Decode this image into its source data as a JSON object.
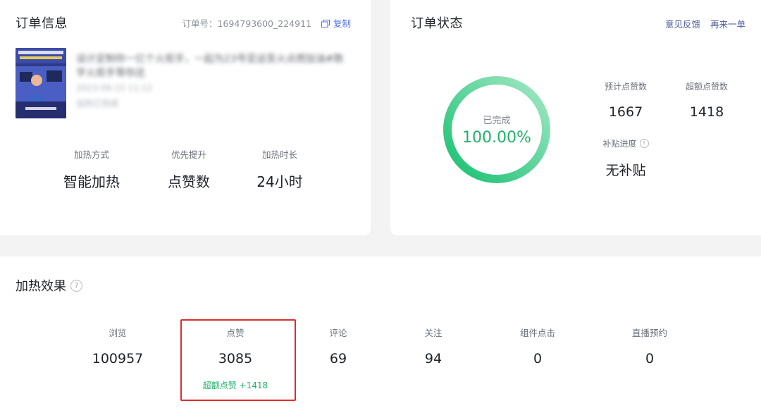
{
  "order_info": {
    "title": "订单信息",
    "order_no_label": "订单号：1694793600_224911",
    "copy_label": "复制",
    "video": {
      "thumbnail_text": "数字人",
      "title": "设计定制你一亿个火炬手，一起为23号亚运圣火点燃加油#数字火炬手等你还",
      "date": "2023-09-15 11:12",
      "status": "加热已完成"
    },
    "stats": [
      {
        "label": "加热方式",
        "value": "智能加热"
      },
      {
        "label": "优先提升",
        "value": "点赞数"
      },
      {
        "label": "加热时长",
        "value": "24小时"
      }
    ]
  },
  "order_status": {
    "title": "订单状态",
    "links": [
      "意见反馈",
      "再来一单"
    ],
    "progress": {
      "label": "已完成",
      "value_text": "100.00%",
      "percent": 100
    },
    "expected_likes": {
      "label": "预计点赞数",
      "value": "1667"
    },
    "extra_likes": {
      "label": "超额点赞数",
      "value": "1418"
    },
    "subsidy": {
      "label": "补贴进度",
      "value": "无补贴",
      "info_icon": "i"
    },
    "colors": {
      "ring_start": "#16c070",
      "ring_end": "#a5e8c6",
      "accent": "#20b26b"
    }
  },
  "effect": {
    "title": "加热效果",
    "help_icon": "?",
    "items": [
      {
        "label": "浏览",
        "value": "100957"
      },
      {
        "label": "点赞",
        "value": "3085",
        "extra": "超额点赞 +1418"
      },
      {
        "label": "评论",
        "value": "69"
      },
      {
        "label": "关注",
        "value": "94"
      },
      {
        "label": "组件点击",
        "value": "0"
      },
      {
        "label": "直播预约",
        "value": "0"
      }
    ],
    "highlight_color": "#e02b2b"
  }
}
